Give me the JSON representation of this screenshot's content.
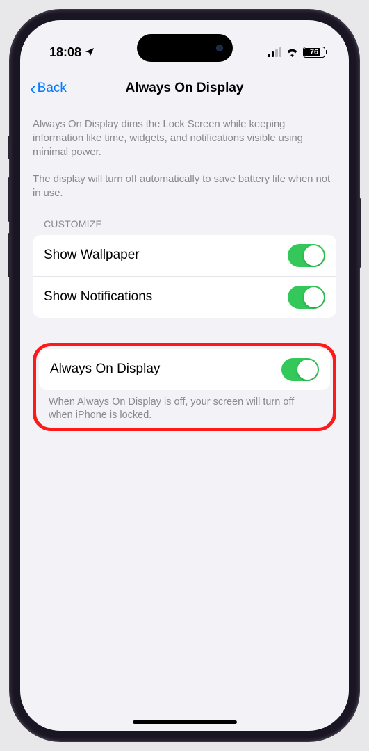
{
  "status": {
    "time": "18:08",
    "battery_pct": "76"
  },
  "nav": {
    "back_label": "Back",
    "title": "Always On Display"
  },
  "intro": {
    "p1": "Always On Display dims the Lock Screen while keeping information like time, widgets, and notifications visible using minimal power.",
    "p2": "The display will turn off automatically to save battery life when not in use."
  },
  "section1": {
    "header": "CUSTOMIZE",
    "rows": [
      {
        "label": "Show Wallpaper",
        "on": true
      },
      {
        "label": "Show Notifications",
        "on": true
      }
    ]
  },
  "section2": {
    "row": {
      "label": "Always On Display",
      "on": true
    },
    "footer": "When Always On Display is off, your screen will turn off when iPhone is locked."
  }
}
